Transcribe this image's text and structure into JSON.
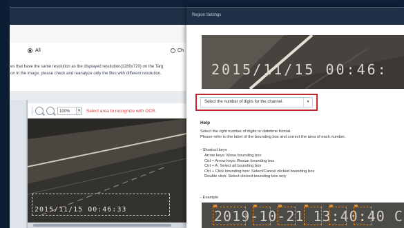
{
  "background_window": {
    "radio_all_label": "All",
    "radio_ch_label": "Ch",
    "notice_line1": "es that have the same resolution as the displayed resolution(1280x720) on the Targ",
    "notice_line2": "on in the image, please check and reanalyze only the files with different resolution.",
    "zoom_value": "100%",
    "ocr_message": "Select area to recognize with OCR.",
    "timestamp": "2015/11/15  00:46:33"
  },
  "dialog": {
    "title": "Region Settings",
    "preview_timestamp": "2015/11/15  00:46:",
    "digits_select_placeholder": "Select the number of digits for the channel.",
    "help_title": "Help",
    "help_line1": "Select the right number of digits or datetime format.",
    "help_line2": "Please refer to the label of the bounding box and correct the area of each number.",
    "shortcuts_title": "- Shortcut keys",
    "shortcuts": [
      "Arrow keys: Move bounding box",
      "Ctrl + Arrow keys: Resize bounding box",
      "Ctrl + A: Select all bounding box",
      "Ctrl + Click bounding box: Select/Cancel clicked bounding box",
      "Double click: Select clicked bounding box only"
    ],
    "example_label": "- Example",
    "example_timestamp": "2019-10-21 13:40:40 C"
  },
  "colors": {
    "highlight_border": "#c0272d",
    "ocr_message": "#e03c3c",
    "bounding_box": "#e38b2c"
  }
}
